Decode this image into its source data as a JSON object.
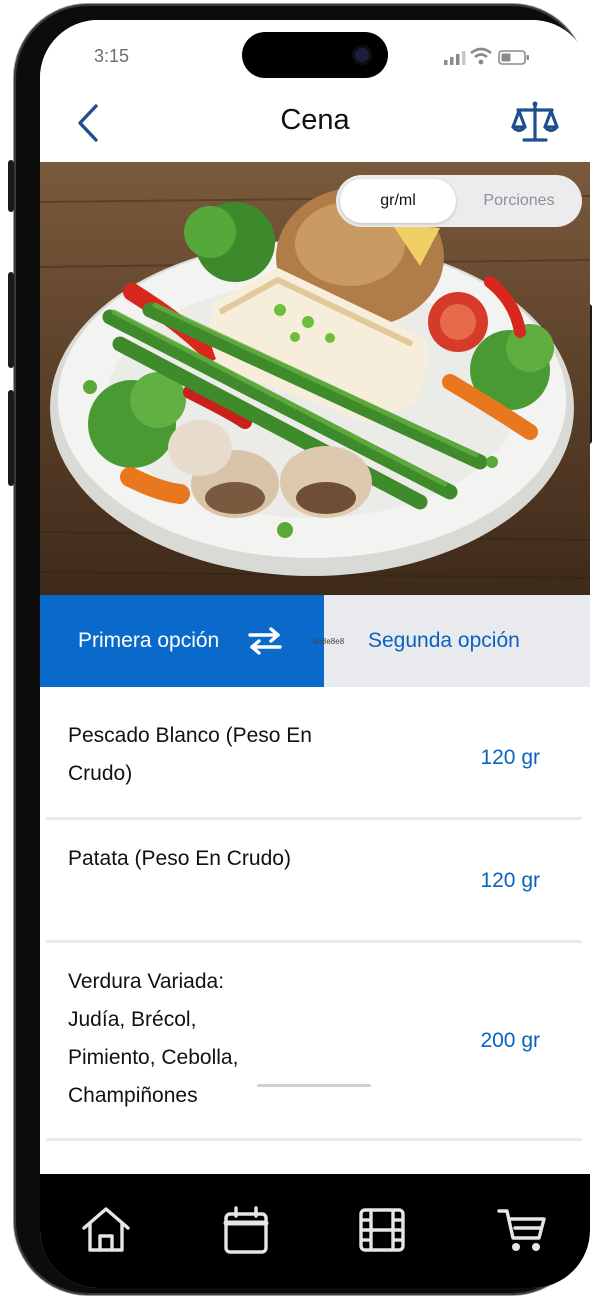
{
  "status_bar": {
    "time": "3:15"
  },
  "header": {
    "title": "Cena",
    "back_icon": "chevron-left-icon",
    "scale_icon": "scale-icon"
  },
  "hero": {
    "image": "plate of white fish with baked potato, asparagus, broccoli, peppers and mushrooms"
  },
  "unit_toggle": {
    "active": "gr/ml",
    "inactive": "Porciones"
  },
  "option_tabs": {
    "first": "Primera opción",
    "second": "Segunda opción",
    "swap_icon": "swap-arrows-icon",
    "overlay_text": "8e8e8e8"
  },
  "items": [
    {
      "name": "Pescado Blanco (Peso En Crudo)",
      "qty": "120 gr"
    },
    {
      "name": "Patata (Peso En Crudo)",
      "qty": "120 gr"
    },
    {
      "name": "Verdura Variada: Judía, Brécol, Pimiento, Cebolla, Champiñones",
      "qty": "200 gr"
    }
  ],
  "bottom_nav": [
    "home-icon",
    "calendar-icon",
    "film-icon",
    "cart-icon"
  ],
  "colors": {
    "accent": "#0a6acb",
    "tab_inactive_bg": "#e9eaee",
    "nav_bg": "#000000"
  }
}
